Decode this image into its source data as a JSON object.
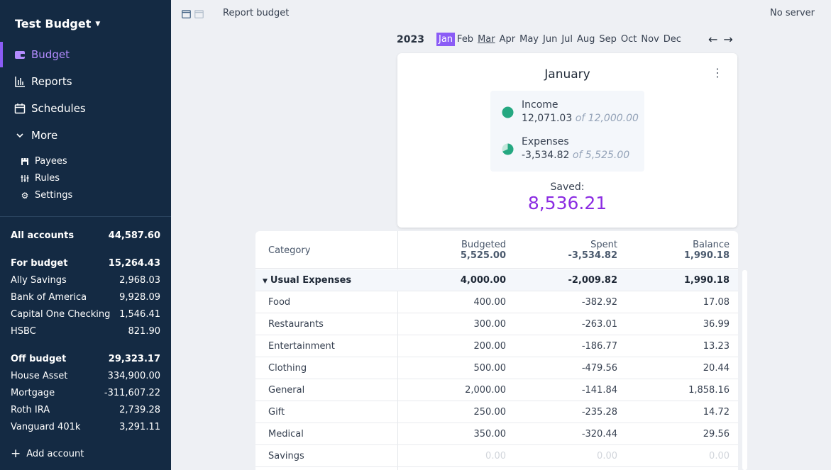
{
  "sidebar": {
    "budget_name": "Test Budget",
    "nav": [
      {
        "label": "Budget",
        "icon": "wallet-icon",
        "active": true
      },
      {
        "label": "Reports",
        "icon": "bar-chart-icon",
        "active": false
      },
      {
        "label": "Schedules",
        "icon": "calendar-icon",
        "active": false
      },
      {
        "label": "More",
        "icon": "chevron-down-icon",
        "active": false
      }
    ],
    "sub_nav": [
      {
        "label": "Payees",
        "icon": "store-icon"
      },
      {
        "label": "Rules",
        "icon": "sliders-icon"
      },
      {
        "label": "Settings",
        "icon": "gear-icon"
      }
    ],
    "all_accounts": {
      "label": "All accounts",
      "value": "44,587.60"
    },
    "for_budget": {
      "label": "For budget",
      "value": "15,264.43"
    },
    "budget_accounts": [
      {
        "name": "Ally Savings",
        "value": "2,968.03"
      },
      {
        "name": "Bank of America",
        "value": "9,928.09"
      },
      {
        "name": "Capital One Checking",
        "value": "1,546.41"
      },
      {
        "name": "HSBC",
        "value": "821.90"
      }
    ],
    "off_budget": {
      "label": "Off budget",
      "value": "29,323.17"
    },
    "off_budget_accounts": [
      {
        "name": "House Asset",
        "value": "334,900.00"
      },
      {
        "name": "Mortgage",
        "value": "-311,607.22"
      },
      {
        "name": "Roth IRA",
        "value": "2,739.28"
      },
      {
        "name": "Vanguard 401k",
        "value": "3,291.11"
      }
    ],
    "add_account": "Add account"
  },
  "topbar": {
    "report_budget": "Report budget",
    "server": "No server"
  },
  "month_selector": {
    "year": "2023",
    "months": [
      "Jan",
      "Feb",
      "Mar",
      "Apr",
      "May",
      "Jun",
      "Jul",
      "Aug",
      "Sep",
      "Oct",
      "Nov",
      "Dec"
    ],
    "selected": "Jan",
    "current": "Mar"
  },
  "summary": {
    "month": "January",
    "income_label": "Income",
    "income_value": "12,071.03",
    "income_of": "of 12,000.00",
    "expenses_label": "Expenses",
    "expenses_value": "-3,534.82",
    "expenses_of": "of 5,525.00",
    "saved_label": "Saved:",
    "saved_value": "8,536.21",
    "colors": {
      "accent": "#8b5cf6",
      "income": "#25a881",
      "saved": "#8b2be2"
    }
  },
  "table": {
    "headers": {
      "category": "Category",
      "budgeted": "Budgeted",
      "budgeted_total": "5,525.00",
      "spent": "Spent",
      "spent_total": "-3,534.82",
      "balance": "Balance",
      "balance_total": "1,990.18"
    },
    "group": {
      "name": "Usual Expenses",
      "budgeted": "4,000.00",
      "spent": "-2,009.82",
      "balance": "1,990.18"
    },
    "rows": [
      {
        "name": "Food",
        "budgeted": "400.00",
        "spent": "-382.92",
        "balance": "17.08"
      },
      {
        "name": "Restaurants",
        "budgeted": "300.00",
        "spent": "-263.01",
        "balance": "36.99"
      },
      {
        "name": "Entertainment",
        "budgeted": "200.00",
        "spent": "-186.77",
        "balance": "13.23"
      },
      {
        "name": "Clothing",
        "budgeted": "500.00",
        "spent": "-479.56",
        "balance": "20.44"
      },
      {
        "name": "General",
        "budgeted": "2,000.00",
        "spent": "-141.84",
        "balance": "1,858.16"
      },
      {
        "name": "Gift",
        "budgeted": "250.00",
        "spent": "-235.28",
        "balance": "14.72"
      },
      {
        "name": "Medical",
        "budgeted": "350.00",
        "spent": "-320.44",
        "balance": "29.56"
      },
      {
        "name": "Savings",
        "budgeted": "0.00",
        "spent": "0.00",
        "balance": "0.00"
      }
    ]
  }
}
